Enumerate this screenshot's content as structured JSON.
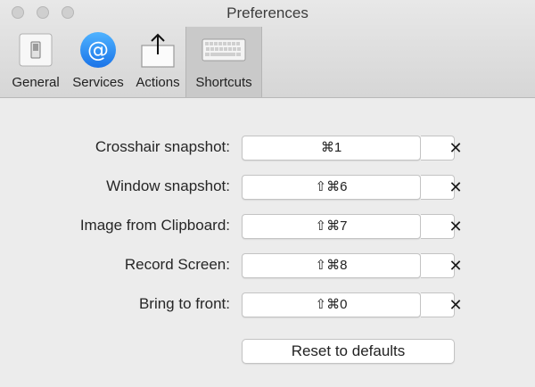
{
  "window": {
    "title": "Preferences"
  },
  "toolbar": {
    "tabs": [
      {
        "label": "General",
        "icon": "switch-icon",
        "selected": false
      },
      {
        "label": "Services",
        "icon": "at-sign-icon",
        "selected": false
      },
      {
        "label": "Actions",
        "icon": "share-icon",
        "selected": false
      },
      {
        "label": "Shortcuts",
        "icon": "keyboard-icon",
        "selected": true
      }
    ]
  },
  "shortcuts": [
    {
      "label": "Crosshair snapshot:",
      "keys": "⌘1"
    },
    {
      "label": "Window snapshot:",
      "keys": "⇧⌘6"
    },
    {
      "label": "Image from Clipboard:",
      "keys": "⇧⌘7"
    },
    {
      "label": "Record Screen:",
      "keys": "⇧⌘8"
    },
    {
      "label": "Bring to front:",
      "keys": "⇧⌘0"
    }
  ],
  "clear_symbol": "✕",
  "reset_label": "Reset to defaults",
  "colors": {
    "services_icon": "#1e88e5",
    "selected_tab_bg": "#c9c9c9"
  }
}
